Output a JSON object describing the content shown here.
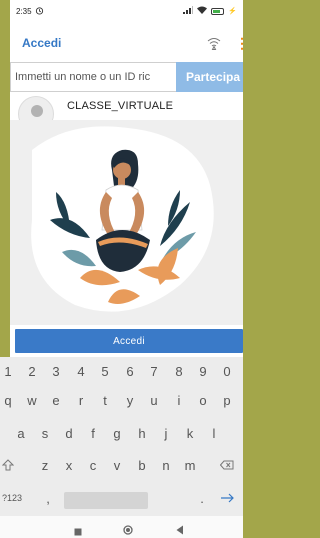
{
  "status": {
    "time": "2:35",
    "battery_level": 0.7
  },
  "appbar": {
    "title": "Accedi"
  },
  "join": {
    "placeholder": "Immetti un nome o un ID ric",
    "button": "Partecipa"
  },
  "class": {
    "name": "CLASSE_VIRTUALE"
  },
  "login": {
    "button": "Accedi"
  },
  "keyboard": {
    "numbers": [
      "1",
      "2",
      "3",
      "4",
      "5",
      "6",
      "7",
      "8",
      "9",
      "0"
    ],
    "row1": [
      "q",
      "w",
      "e",
      "r",
      "t",
      "y",
      "u",
      "i",
      "o",
      "p"
    ],
    "row2": [
      "a",
      "s",
      "d",
      "f",
      "g",
      "h",
      "j",
      "k",
      "l"
    ],
    "row3": [
      "z",
      "x",
      "c",
      "v",
      "b",
      "n",
      "m"
    ],
    "symbols_key": "?123",
    "comma": ",",
    "period": "."
  },
  "colors": {
    "accent": "#3578c5",
    "join_button": "#8fbbe6",
    "login_button": "#3a7ac8",
    "menu": "#f08a17",
    "frame": "#a3a64a"
  }
}
